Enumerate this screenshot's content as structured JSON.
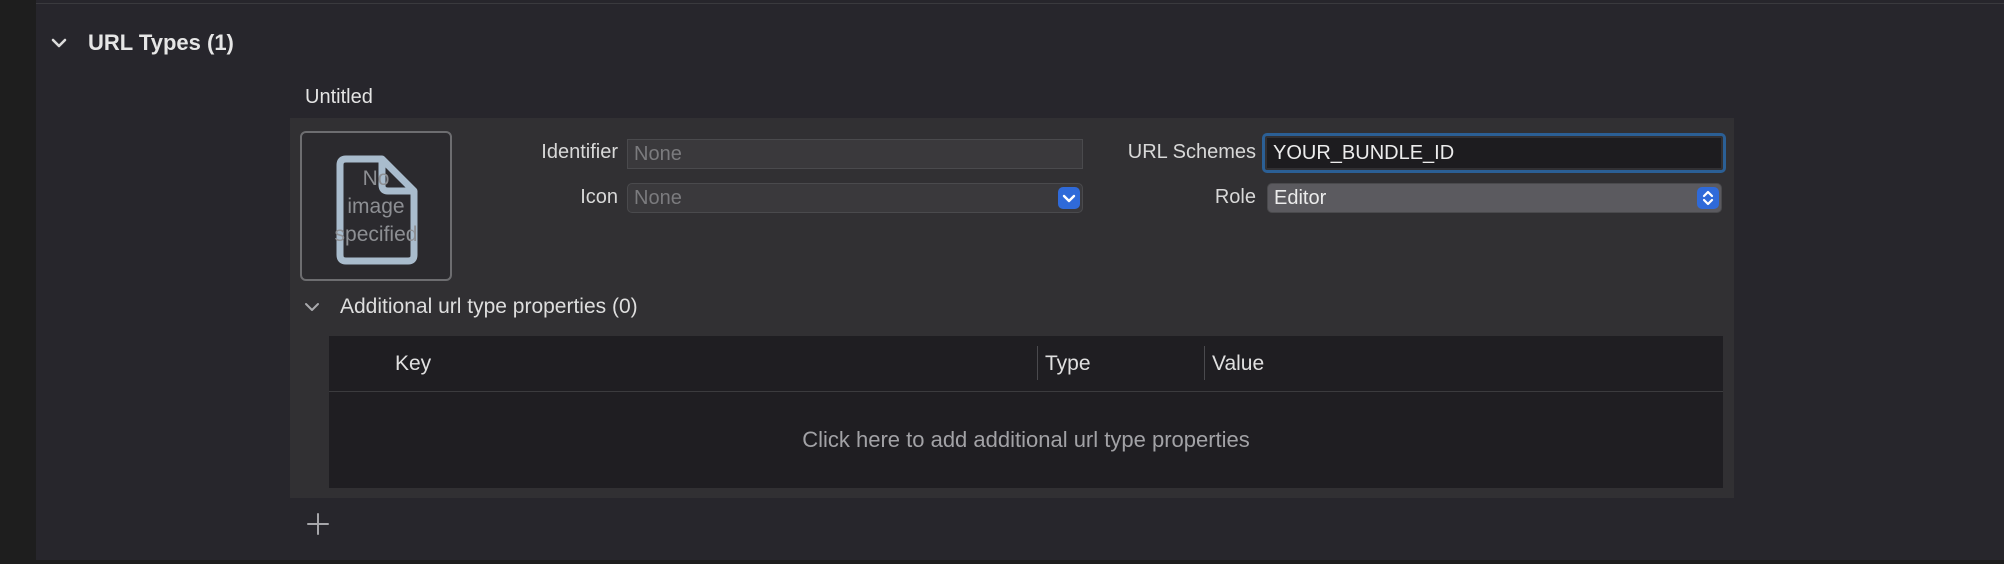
{
  "section": {
    "title": "URL Types (1)",
    "icon": "chevron-down-icon"
  },
  "entry": {
    "title": "Untitled",
    "image_well": {
      "text": "No\nimage\nspecified",
      "icon": "document-icon"
    },
    "identifier": {
      "label": "Identifier",
      "value": "",
      "placeholder": "None"
    },
    "icon_field": {
      "label": "Icon",
      "value": "None"
    },
    "url_schemes": {
      "label": "URL Schemes",
      "value": "YOUR_BUNDLE_ID"
    },
    "role": {
      "label": "Role",
      "value": "Editor"
    }
  },
  "additional": {
    "title": "Additional url type properties (0)",
    "columns": [
      "Key",
      "Type",
      "Value"
    ],
    "empty_text": "Click here to add additional url type properties"
  },
  "toolbar": {
    "add_icon": "plus-icon"
  },
  "colors": {
    "accent": "#2f6ad9",
    "focus_ring": "#2b5f95",
    "panel_bg": "#27262c"
  }
}
